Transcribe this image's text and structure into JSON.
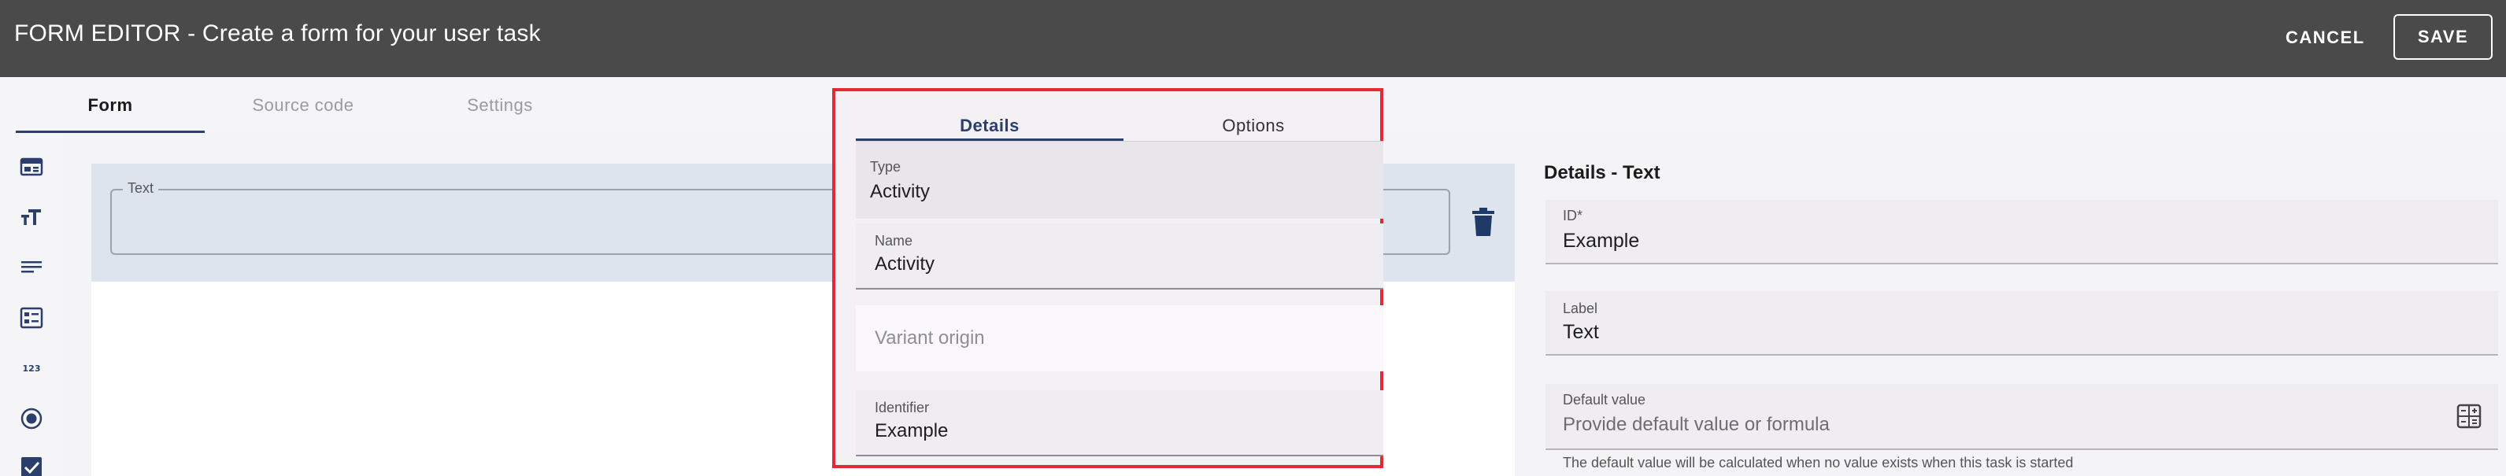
{
  "header": {
    "title": "FORM EDITOR - Create a form for your user task",
    "cancel_label": "CANCEL",
    "save_label": "SAVE"
  },
  "main_tabs": [
    {
      "label": "Form",
      "active": true
    },
    {
      "label": "Source code",
      "active": false
    },
    {
      "label": "Settings",
      "active": false
    }
  ],
  "toolbar": {
    "icons": [
      "card-layout-icon",
      "text-size-icon",
      "paragraph-icon",
      "form-list-icon",
      "numeric-123-icon",
      "radio-button-icon",
      "checkbox-icon"
    ]
  },
  "canvas": {
    "selected_field_label": "Text"
  },
  "overlay": {
    "tabs": [
      {
        "label": "Details",
        "active": true
      },
      {
        "label": "Options",
        "active": false
      }
    ],
    "type": {
      "label": "Type",
      "value": "Activity"
    },
    "name": {
      "label": "Name",
      "value": "Activity"
    },
    "variant_origin": {
      "placeholder": "Variant origin"
    },
    "identifier": {
      "label": "Identifier",
      "value": "Example"
    }
  },
  "details": {
    "title": "Details - Text",
    "id": {
      "label": "ID*",
      "value": "Example"
    },
    "label_field": {
      "label": "Label",
      "value": "Text"
    },
    "default_value": {
      "label": "Default value",
      "placeholder": "Provide default value or formula",
      "helper": "The default value will be calculated when no value exists when this task is started"
    }
  },
  "colors": {
    "header_bg": "#4a4a4a",
    "accent": "#2b3e6c",
    "highlight_border": "#e12b34",
    "selected_field_bg": "#dde4ee"
  }
}
